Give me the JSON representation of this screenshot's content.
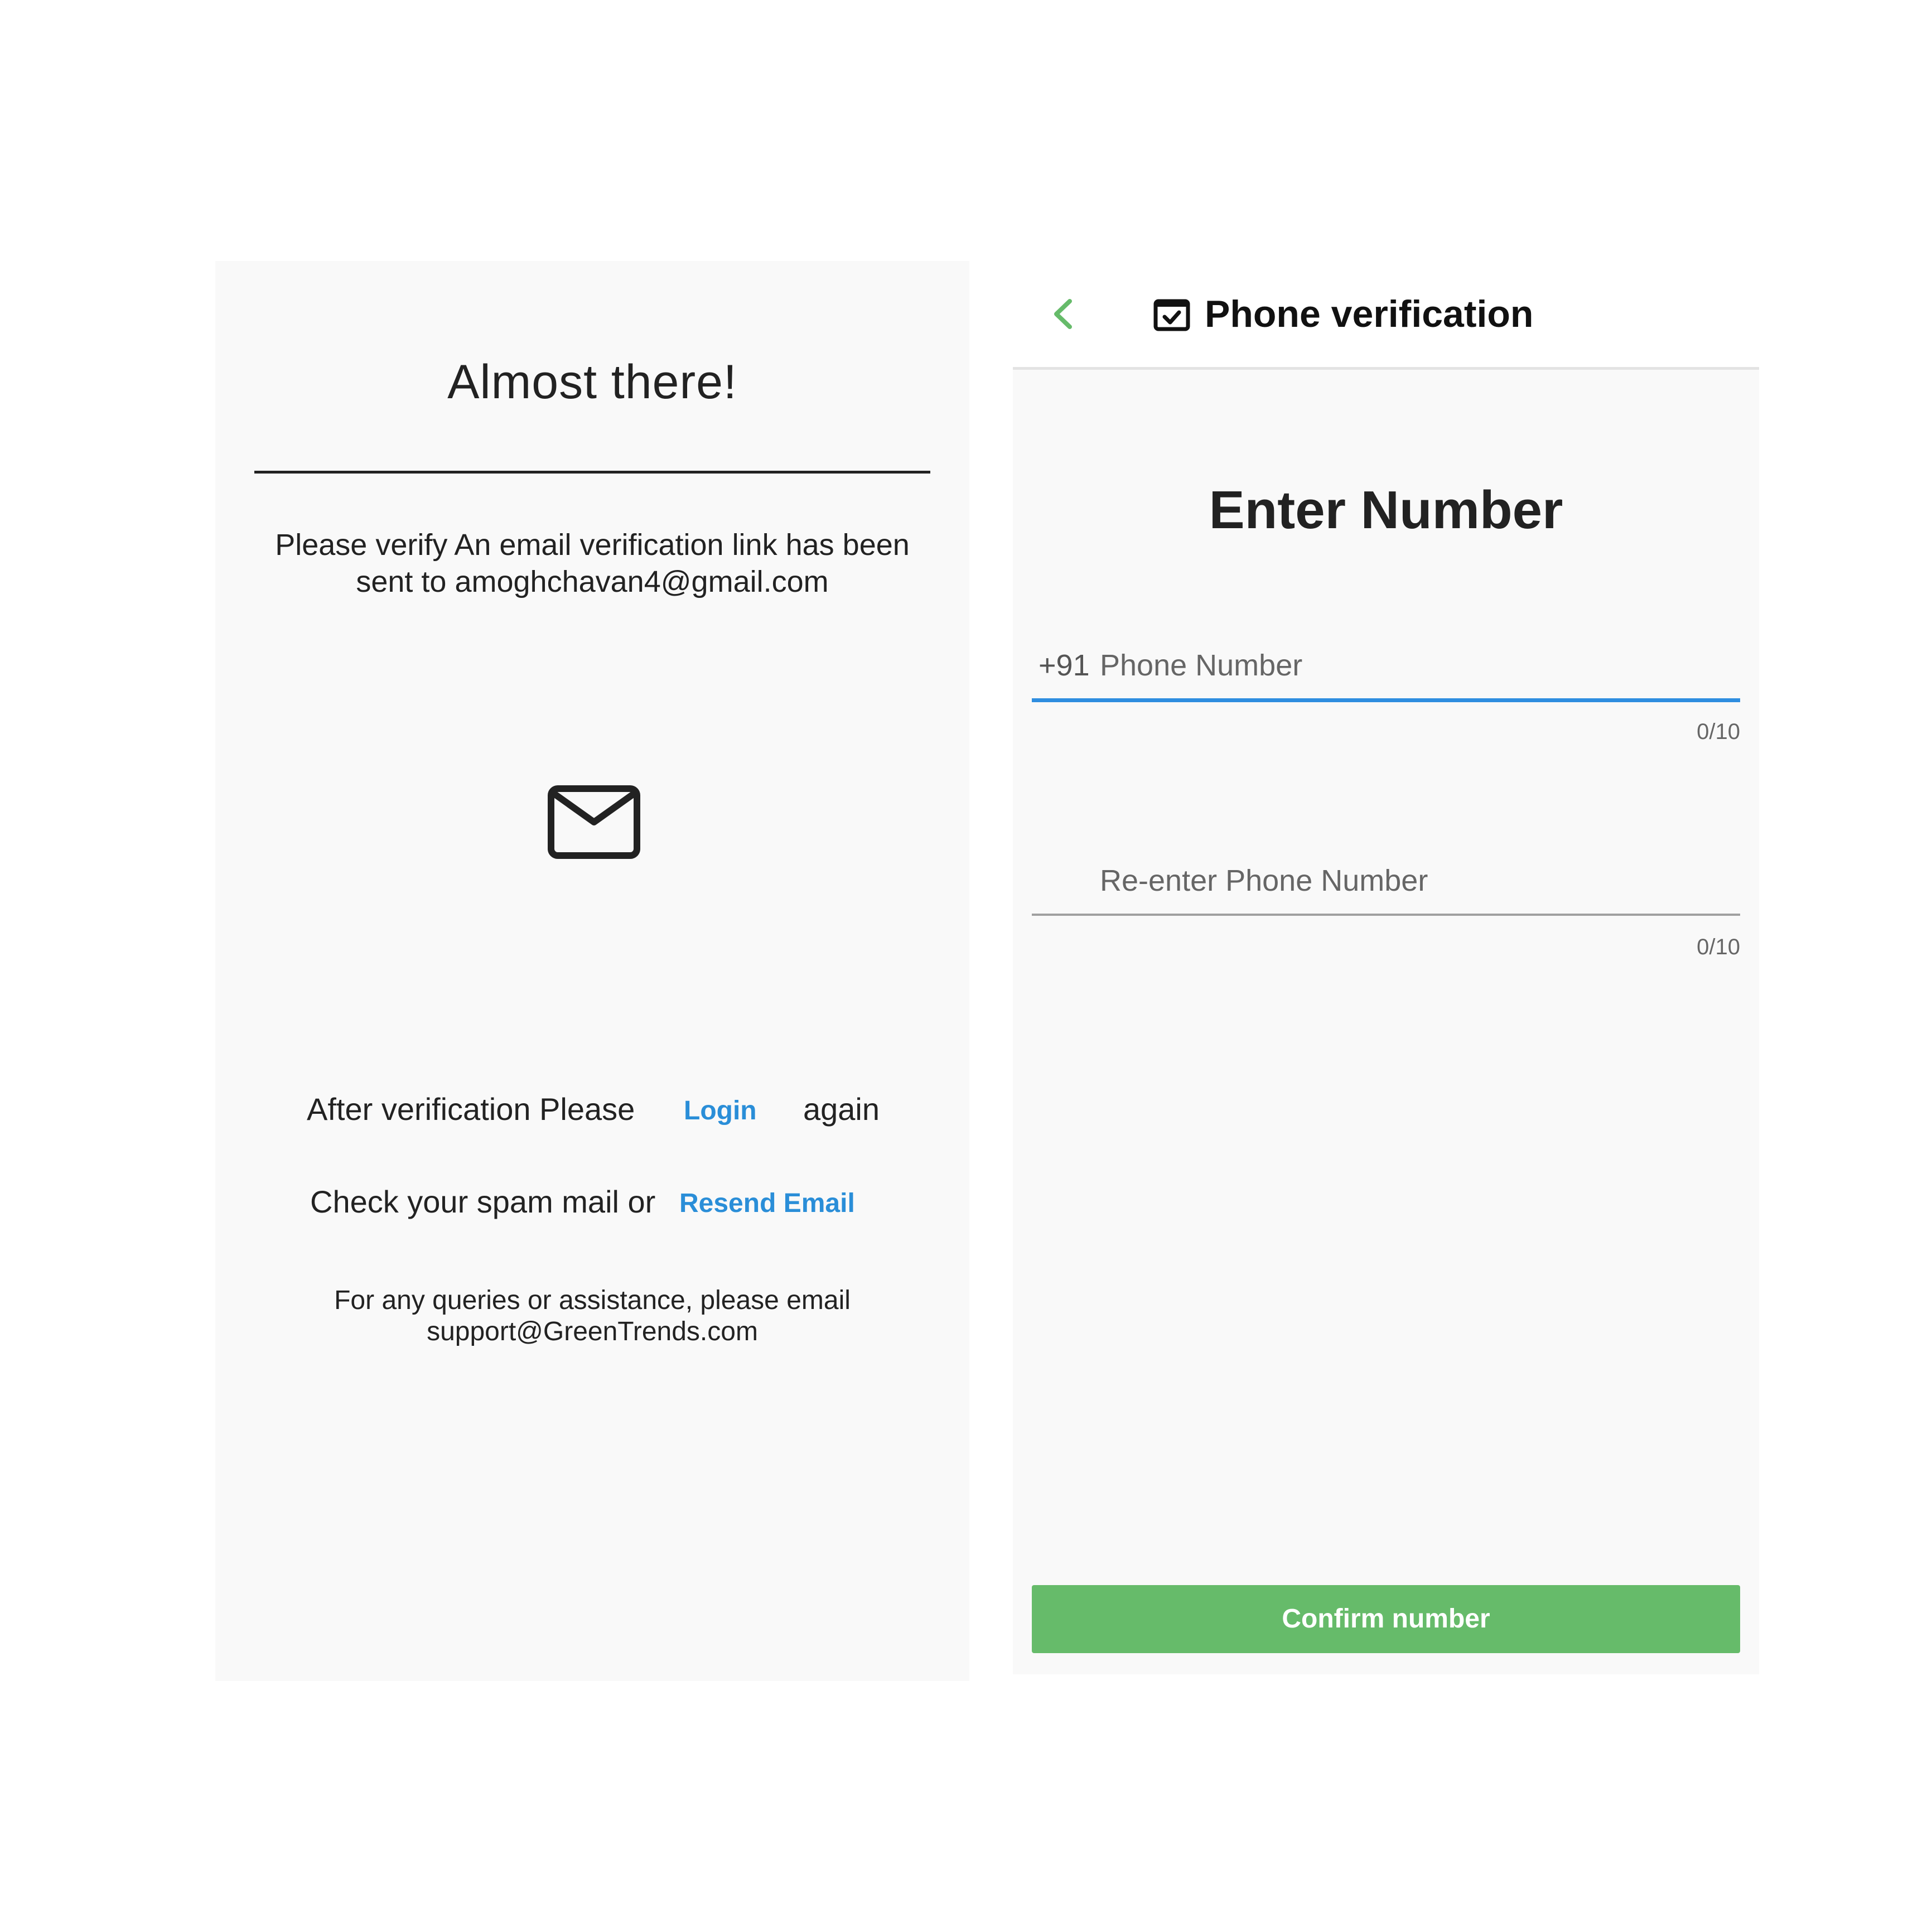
{
  "email_screen": {
    "title": "Almost there!",
    "message": "Please verify An email verification link has been sent to amoghchavan4@gmail.com",
    "icon": "mail-icon",
    "after_verification_text": "After verification Please",
    "login_link": "Login",
    "again_text": "again",
    "spam_text": "Check your spam mail or",
    "resend_link": "Resend Email",
    "support_text": "For any queries or assistance, please email support@GreenTrends.com",
    "link_color": "#2a8ed8"
  },
  "phone_screen": {
    "appbar": {
      "back_icon": "chevron-left-icon",
      "title_icon": "calendar-check-icon",
      "title": "Phone verification"
    },
    "heading": "Enter Number",
    "phone_field": {
      "prefix": "+91",
      "placeholder": "Phone Number",
      "counter": "0/10",
      "focused": true
    },
    "reenter_field": {
      "placeholder": "Re-enter Phone Number",
      "counter": "0/10",
      "focused": false
    },
    "confirm_button": "Confirm number",
    "accent_green": "#66bb6a",
    "focus_blue": "#2f8ee0"
  }
}
